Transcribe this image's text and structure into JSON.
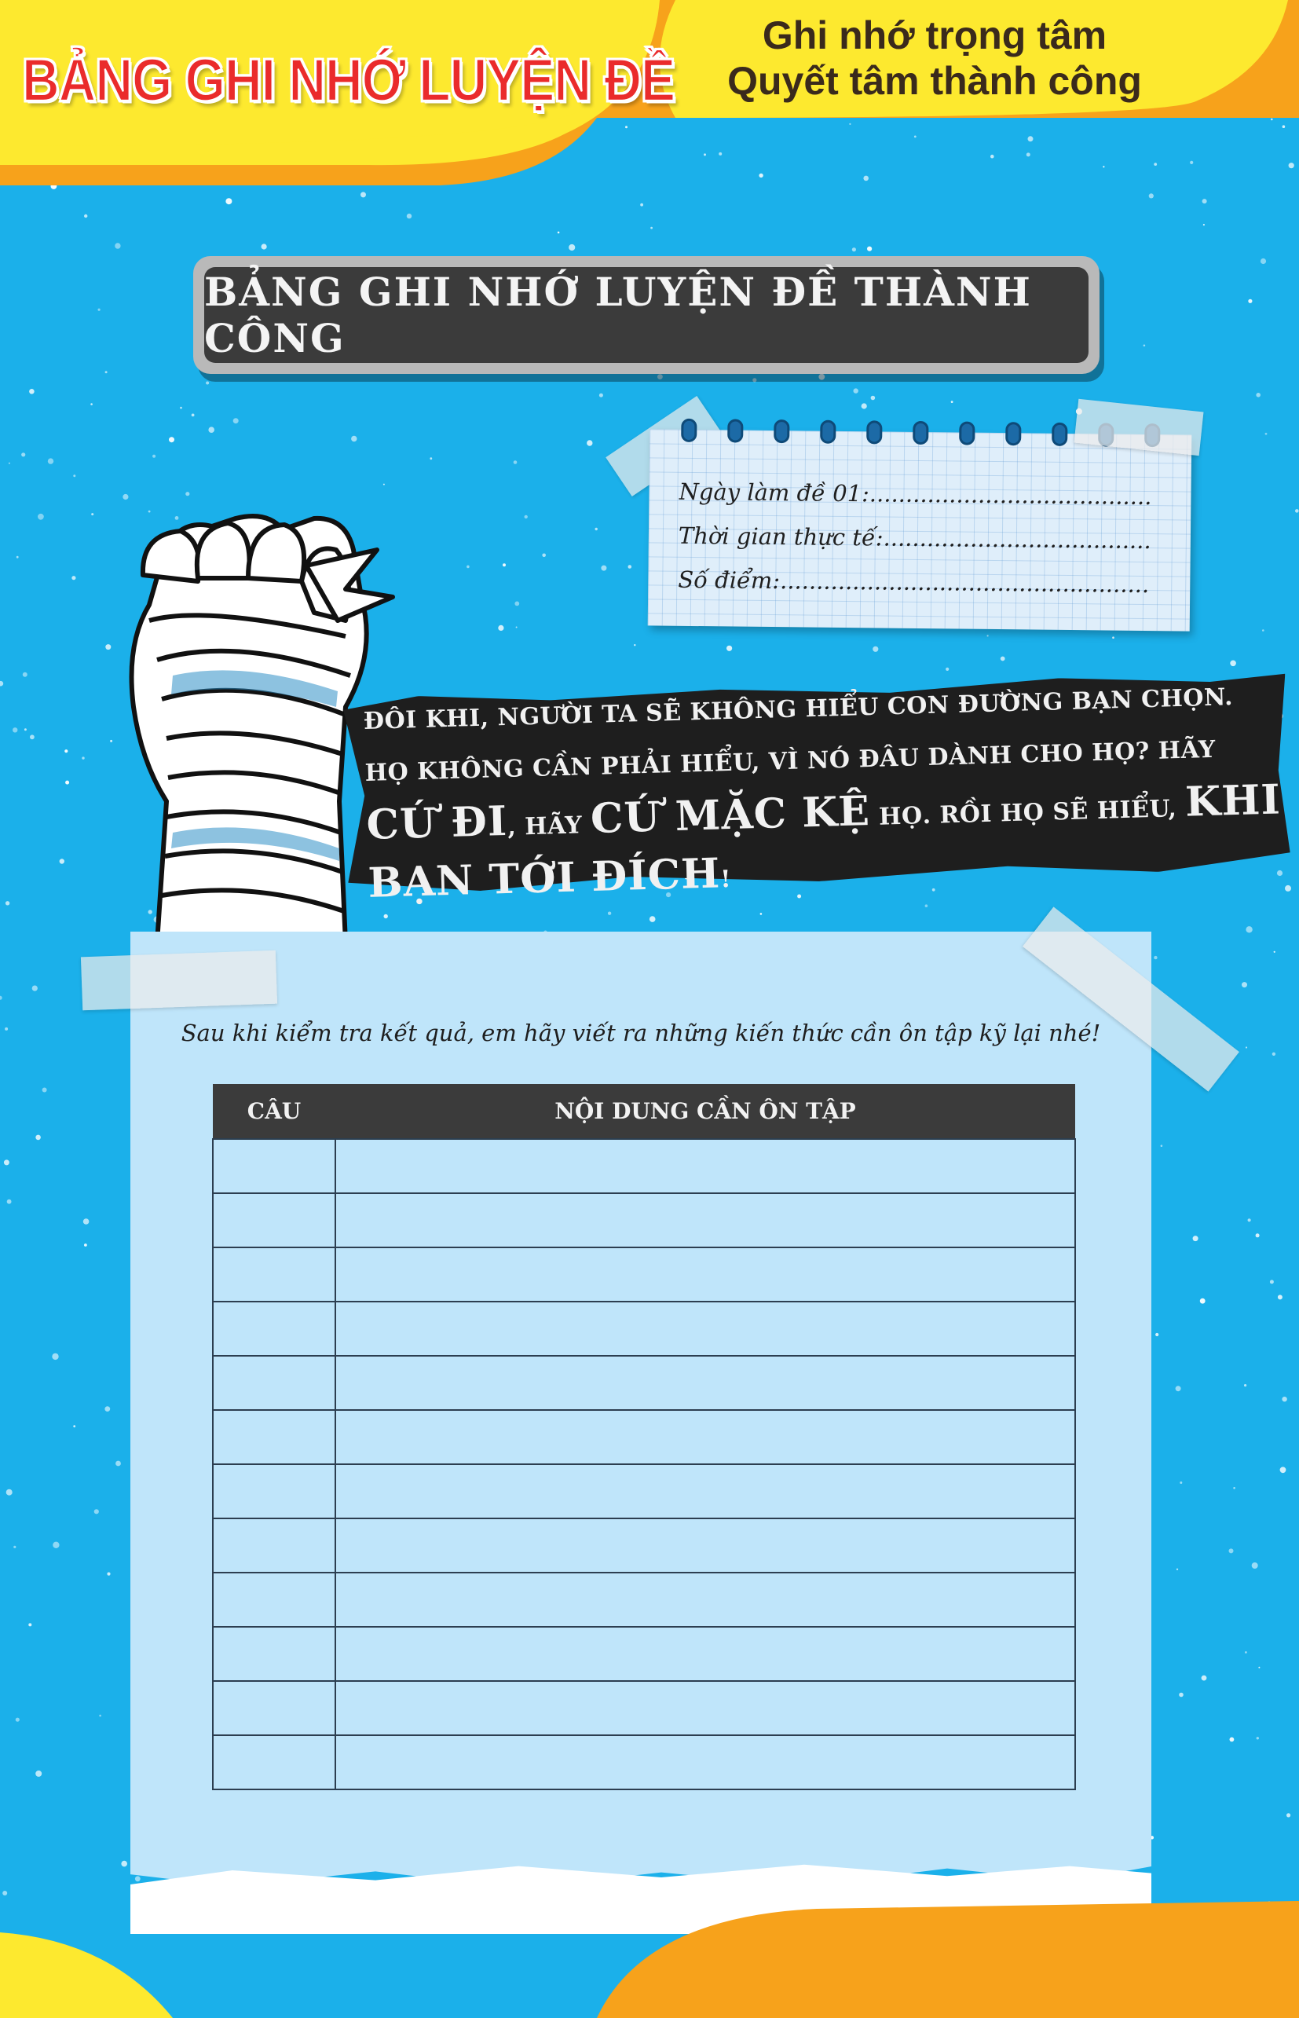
{
  "header": {
    "brand_title": "BẢNG GHI NHỚ LUYỆN ĐỀ",
    "slogan_line1": "Ghi nhớ trọng tâm",
    "slogan_line2": "Quyết tâm thành công"
  },
  "main_title": "BẢNG GHI NHỚ LUYỆN ĐỀ THÀNH CÔNG",
  "note_card": {
    "exam_date": "Ngày làm đề 01:.......................................................",
    "actual_time": "Thời gian thực tế:..................................................",
    "score": "Số điểm:.....................................................................",
    "ring_count": 11
  },
  "quote": {
    "part1": "Đôi khi, người ta sẽ không hiểu con đường bạn chọn. Họ không cần phải hiểu, vì nó đâu dành cho họ? Hãy ",
    "emph1": "cứ đi",
    "part2": ", hãy ",
    "emph2": "cứ mặc kệ",
    "part3": " họ. Rồi họ sẽ hiểu, ",
    "emph3": "khi bạn tới đích",
    "part4": "!"
  },
  "review": {
    "instruction": "Sau khi kiểm tra kết quả, em hãy viết ra những kiến thức cần ôn tập kỹ lại nhé!",
    "col_question": "Câu",
    "col_content": "Nội dung cần ôn tập",
    "row_count": 12
  },
  "colors": {
    "background": "#1bb0ea",
    "banner_yellow": "#fde92f",
    "banner_orange": "#f7a21b",
    "brand_red": "#ea2b2b",
    "plate_dark": "#3b3b3b",
    "paper_blue": "#bfe5fa"
  }
}
